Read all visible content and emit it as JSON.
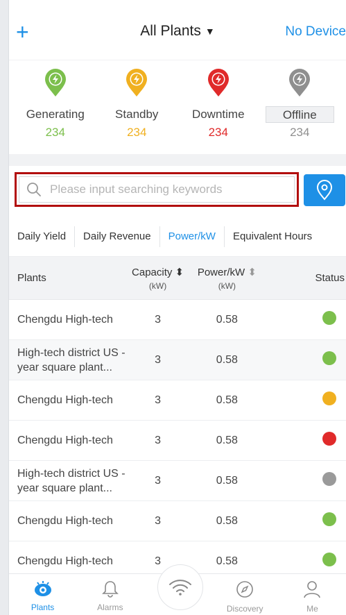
{
  "header": {
    "add_icon": "plus-icon",
    "title": "All Plants",
    "right_label": "No Device"
  },
  "status": [
    {
      "label": "Generating",
      "count": "234",
      "color": "#7cbf4c"
    },
    {
      "label": "Standby",
      "count": "234",
      "color": "#f0b020"
    },
    {
      "label": "Downtime",
      "count": "234",
      "color": "#e02a2a"
    },
    {
      "label": "Offline",
      "count": "234",
      "color": "#8f8f8f"
    }
  ],
  "search": {
    "placeholder": "Please input searching keywords",
    "locate_icon": "location-pin-icon",
    "highlight_color": "#b20e0e"
  },
  "tabs": [
    {
      "label": "Daily Yield"
    },
    {
      "label": "Daily Revenue"
    },
    {
      "label": "Power/kW",
      "active": true
    },
    {
      "label": "Equivalent Hours"
    }
  ],
  "table": {
    "headers": {
      "plants": "Plants",
      "capacity": "Capacity",
      "capacity_unit": "(kW)",
      "power": "Power/kW",
      "power_unit": "(kW)",
      "status": "Status"
    },
    "rows": [
      {
        "name": "Chengdu High-tech",
        "capacity": "3",
        "power": "0.58",
        "status": "generating"
      },
      {
        "name": "High-tech district US -year square plant...",
        "capacity": "3",
        "power": "0.58",
        "status": "generating"
      },
      {
        "name": "Chengdu High-tech",
        "capacity": "3",
        "power": "0.58",
        "status": "standby"
      },
      {
        "name": "Chengdu High-tech",
        "capacity": "3",
        "power": "0.58",
        "status": "downtime"
      },
      {
        "name": "High-tech district US -year square plant...",
        "capacity": "3",
        "power": "0.58",
        "status": "offline"
      },
      {
        "name": "Chengdu High-tech",
        "capacity": "3",
        "power": "0.58",
        "status": "generating"
      },
      {
        "name": "Chengdu High-tech",
        "capacity": "3",
        "power": "0.58",
        "status": "generating"
      }
    ]
  },
  "nav": [
    {
      "label": "Plants",
      "icon": "plants-eye-icon",
      "active": true
    },
    {
      "label": "Alarms",
      "icon": "bell-icon"
    },
    {
      "label": "",
      "icon": "wifi-icon"
    },
    {
      "label": "Discovery",
      "icon": "compass-icon"
    },
    {
      "label": "Me",
      "icon": "person-icon"
    }
  ],
  "colors": {
    "accent": "#1e90e6",
    "generating": "#7cbf4c",
    "standby": "#f0b020",
    "downtime": "#e02a2a",
    "offline": "#9a9a9a"
  }
}
